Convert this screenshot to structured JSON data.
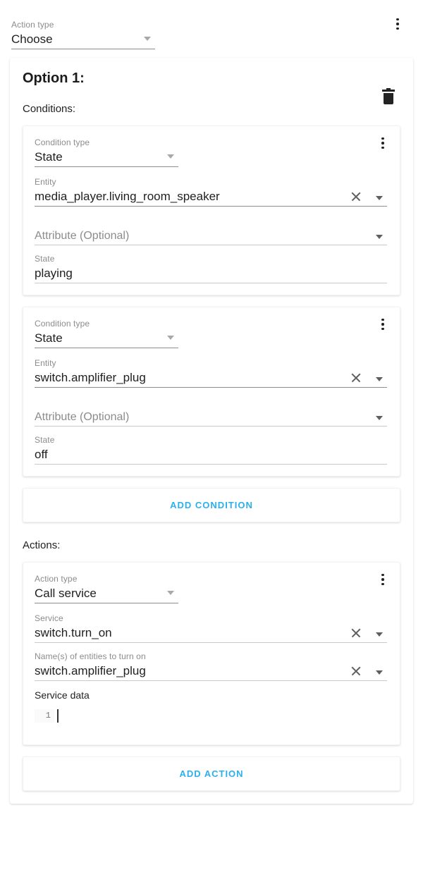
{
  "top": {
    "action_type_label": "Action type",
    "action_type_value": "Choose",
    "menu_icon": "overflow-menu-icon"
  },
  "option": {
    "title": "Option 1:",
    "delete_icon": "trash-icon",
    "conditions_label": "Conditions:",
    "actions_label": "Actions:",
    "add_condition_label": "ADD CONDITION",
    "add_action_label": "ADD ACTION"
  },
  "conditions": [
    {
      "type_label": "Condition type",
      "type_value": "State",
      "entity_label": "Entity",
      "entity_value": "media_player.living_room_speaker",
      "attribute_placeholder": "Attribute (Optional)",
      "state_label": "State",
      "state_value": "playing"
    },
    {
      "type_label": "Condition type",
      "type_value": "State",
      "entity_label": "Entity",
      "entity_value": "switch.amplifier_plug",
      "attribute_placeholder": "Attribute (Optional)",
      "state_label": "State",
      "state_value": "off"
    }
  ],
  "actions": [
    {
      "type_label": "Action type",
      "type_value": "Call service",
      "service_label": "Service",
      "service_value": "switch.turn_on",
      "entities_label": "Name(s) of entities to turn on",
      "entities_value": "switch.amplifier_plug",
      "service_data_label": "Service data",
      "code_line_number": "1",
      "code_line_content": ""
    }
  ],
  "colors": {
    "accent": "#2bb0ee",
    "text": "#1f1f1f",
    "muted": "#8c8c8c",
    "underline": "#8d8d8d"
  }
}
